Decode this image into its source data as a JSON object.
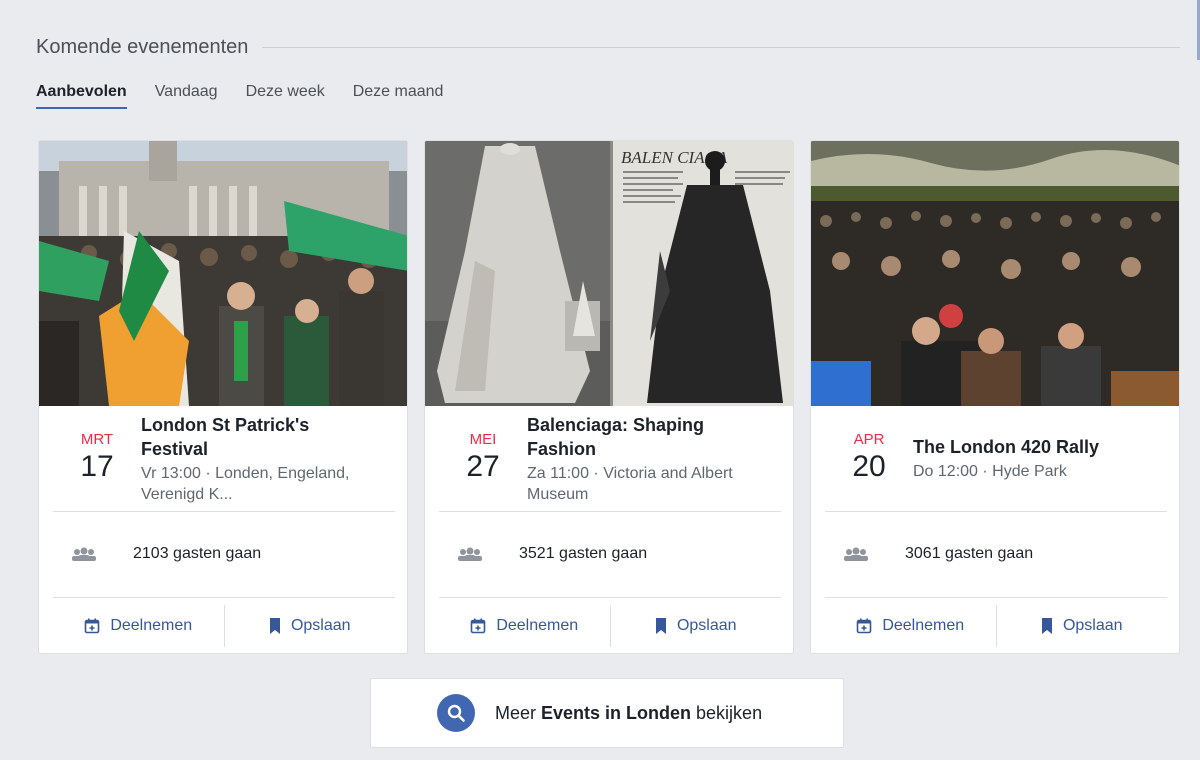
{
  "section": {
    "title": "Komende evenementen"
  },
  "tabs": [
    {
      "label": "Aanbevolen",
      "active": true
    },
    {
      "label": "Vandaag",
      "active": false
    },
    {
      "label": "Deze week",
      "active": false
    },
    {
      "label": "Deze maand",
      "active": false
    }
  ],
  "events": [
    {
      "month": "MRT",
      "day": "17",
      "title": "London St Patrick's Festival",
      "meta": "Vr 13:00 · Londen, Engeland, Verenigd K...",
      "guests": "2103 gasten gaan",
      "join_label": "Deelnemen",
      "save_label": "Opslaan"
    },
    {
      "month": "MEI",
      "day": "27",
      "title": "Balenciaga: Shaping Fashion",
      "meta": "Za 11:00 · Victoria and Albert Museum",
      "guests": "3521 gasten gaan",
      "join_label": "Deelnemen",
      "save_label": "Opslaan",
      "image_text": "BALEN   CIAGA"
    },
    {
      "month": "APR",
      "day": "20",
      "title": "The London 420 Rally",
      "meta": "Do 12:00 · Hyde Park",
      "guests": "3061 gasten gaan",
      "join_label": "Deelnemen",
      "save_label": "Opslaan"
    }
  ],
  "more_button": {
    "prefix": "Meer ",
    "bold": "Events in Londen",
    "suffix": " bekijken"
  },
  "colors": {
    "accent": "#4267b2",
    "link": "#365899",
    "date_red": "#f02849",
    "background": "#e9ebee"
  },
  "icons": {
    "guests": "people-icon",
    "join": "calendar-plus-icon",
    "save": "bookmark-icon",
    "search": "search-icon"
  }
}
